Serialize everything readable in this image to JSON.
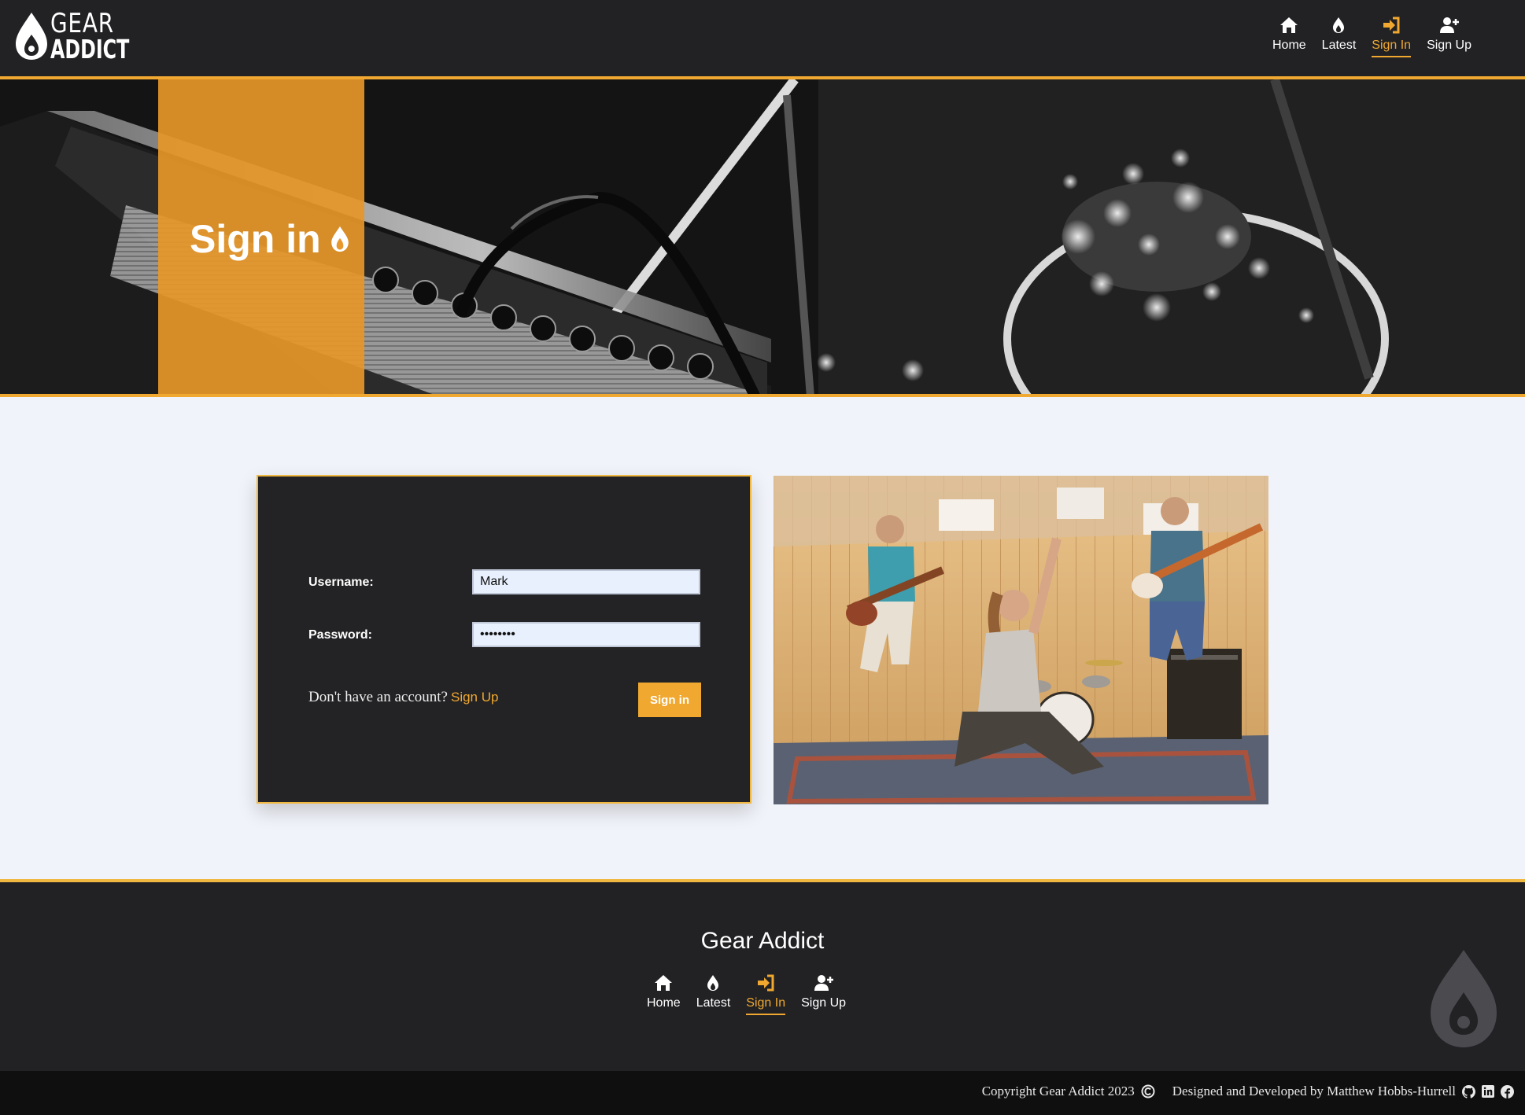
{
  "brand": {
    "line1": "GEAR",
    "line2": "ADDICT"
  },
  "nav": [
    {
      "label": "Home",
      "icon": "home-icon",
      "active": false
    },
    {
      "label": "Latest",
      "icon": "flame-icon",
      "active": false
    },
    {
      "label": "Sign In",
      "icon": "sign-in-icon",
      "active": true
    },
    {
      "label": "Sign Up",
      "icon": "user-plus-icon",
      "active": false
    }
  ],
  "hero": {
    "title": "Sign in",
    "icon": "flame-icon"
  },
  "form": {
    "username_label": "Username:",
    "username_value": "Mark",
    "password_label": "Password:",
    "password_value": "••••••••",
    "no_account_text": "Don't have an account?",
    "signup_link": "Sign Up",
    "submit_label": "Sign in"
  },
  "footer": {
    "title": "Gear Addict",
    "copyright": "Copyright Gear Addict 2023",
    "credit": "Designed and Developed by Matthew Hobbs-Hurrell",
    "social_icons": [
      "github-icon",
      "linkedin-icon",
      "facebook-icon"
    ]
  },
  "colors": {
    "accent": "#f0a830",
    "dark": "#222225",
    "page": "#f0f3f9"
  }
}
